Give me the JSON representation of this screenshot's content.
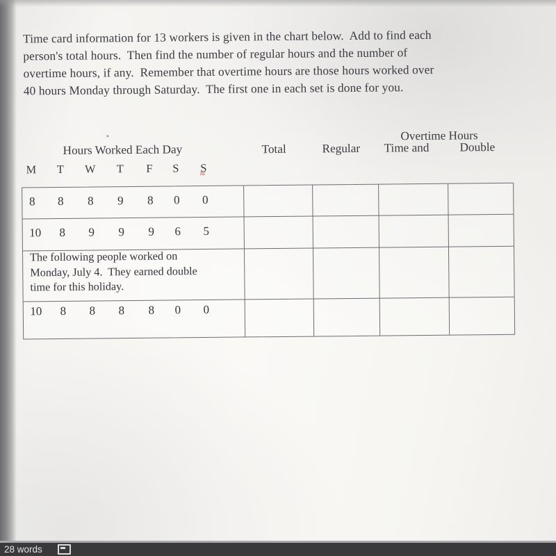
{
  "document": {
    "instructions": [
      "Time card information for 13 workers is given in the chart below.  Add to find each",
      "person's total hours.  Then find the number of regular hours and the number of",
      "overtime hours, if any.  Remember that overtime hours are those hours worked over",
      "40 hours Monday through Saturday.  The first one in each set is done for you."
    ],
    "headers": {
      "hours_worked_each_day": "Hours Worked Each Day",
      "overtime_hours": "Overtime Hours",
      "total": "Total",
      "regular": "Regular",
      "time_and": "Time and",
      "double": "Double",
      "days": [
        "M",
        "T",
        "W",
        "T",
        "F",
        "S",
        "S"
      ],
      "red_pen_mark": "≈"
    },
    "table": {
      "column_headers": [
        "M",
        "T",
        "W",
        "T",
        "F",
        "S",
        "S",
        "Total",
        "Regular",
        "Time and",
        "Double"
      ],
      "rows": [
        {
          "type": "hours",
          "hours": [
            "8",
            "8",
            "8",
            "9",
            "8",
            "0",
            "0"
          ],
          "total": "",
          "regular": "",
          "time_and": "",
          "double": ""
        },
        {
          "type": "hours",
          "hours": [
            "10",
            "8",
            "9",
            "9",
            "9",
            "6",
            "5"
          ],
          "total": "",
          "regular": "",
          "time_and": "",
          "double": ""
        },
        {
          "type": "note",
          "note_lines": [
            "The following people worked on",
            "Monday, July 4.  They earned double",
            "time for this holiday."
          ],
          "total": "",
          "regular": "",
          "time_and": "",
          "double": ""
        },
        {
          "type": "hours",
          "hours": [
            "10",
            "8",
            "8",
            "8",
            "8",
            "0",
            "0"
          ],
          "total": "",
          "regular": "",
          "time_and": "",
          "double": ""
        }
      ]
    }
  },
  "statusbar": {
    "word_count": "28 words",
    "icon": "page-view-icon"
  },
  "colors": {
    "paper": "#f7f6f3",
    "ink": "#3b3c42",
    "rule": "#6f6a72",
    "red_pen": "#c0392b",
    "statusbar_bg": "#39393b"
  }
}
